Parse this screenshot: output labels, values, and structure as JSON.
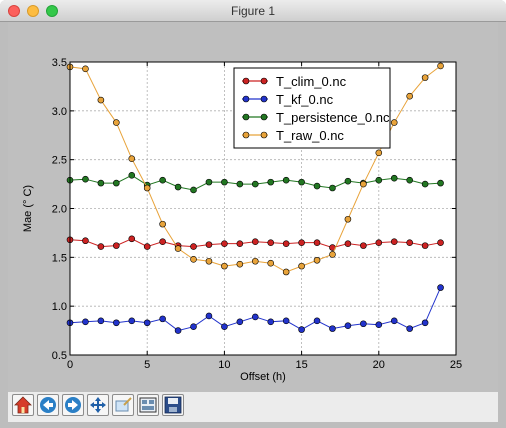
{
  "window": {
    "title": "Figure 1"
  },
  "toolbar": {
    "buttons": [
      {
        "name": "home-button",
        "icon": "home-icon"
      },
      {
        "name": "back-button",
        "icon": "arrow-left-icon"
      },
      {
        "name": "forward-button",
        "icon": "arrow-right-icon"
      },
      {
        "name": "pan-button",
        "icon": "move-icon"
      },
      {
        "name": "zoom-button",
        "icon": "zoom-rect-icon"
      },
      {
        "name": "subplots-button",
        "icon": "subplots-icon"
      },
      {
        "name": "save-button",
        "icon": "save-icon"
      }
    ]
  },
  "chart_data": {
    "type": "line",
    "title": "",
    "xlabel": "Offset (h)",
    "ylabel": "Mae (° C)",
    "xlim": [
      0,
      25
    ],
    "ylim": [
      0.5,
      3.5
    ],
    "xticks": [
      0,
      5,
      10,
      15,
      20,
      25
    ],
    "yticks": [
      0.5,
      1.0,
      1.5,
      2.0,
      2.5,
      3.0,
      3.5
    ],
    "xtick_labels": [
      "0",
      "5",
      "10",
      "15",
      "20",
      "25"
    ],
    "ytick_labels": [
      "0.5",
      "1.0",
      "1.5",
      "2.0",
      "2.5",
      "3.0",
      "3.5"
    ],
    "grid": true,
    "legend_position": "top-right",
    "x": [
      0,
      1,
      2,
      3,
      4,
      5,
      6,
      7,
      8,
      9,
      10,
      11,
      12,
      13,
      14,
      15,
      16,
      17,
      18,
      19,
      20,
      21,
      22,
      23,
      24
    ],
    "series": [
      {
        "name": "T_clim_0.nc",
        "color": "#cc2222",
        "values": [
          1.68,
          1.67,
          1.61,
          1.62,
          1.69,
          1.61,
          1.66,
          1.62,
          1.61,
          1.63,
          1.64,
          1.64,
          1.66,
          1.65,
          1.64,
          1.65,
          1.65,
          1.6,
          1.64,
          1.62,
          1.65,
          1.66,
          1.65,
          1.62,
          1.65
        ]
      },
      {
        "name": "T_kf_0.nc",
        "color": "#2233cc",
        "values": [
          0.83,
          0.84,
          0.85,
          0.83,
          0.85,
          0.83,
          0.87,
          0.75,
          0.79,
          0.9,
          0.79,
          0.84,
          0.89,
          0.84,
          0.85,
          0.76,
          0.85,
          0.77,
          0.8,
          0.82,
          0.81,
          0.85,
          0.77,
          0.83,
          1.19
        ]
      },
      {
        "name": "T_persistence_0.nc",
        "color": "#227722",
        "values": [
          2.29,
          2.3,
          2.26,
          2.26,
          2.34,
          2.24,
          2.29,
          2.22,
          2.19,
          2.27,
          2.27,
          2.25,
          2.25,
          2.27,
          2.29,
          2.27,
          2.23,
          2.21,
          2.28,
          2.26,
          2.29,
          2.31,
          2.29,
          2.25,
          2.26
        ]
      },
      {
        "name": "T_raw_0.nc",
        "color": "#e8a33a",
        "values": [
          3.45,
          3.43,
          3.11,
          2.88,
          2.51,
          2.21,
          1.84,
          1.59,
          1.48,
          1.46,
          1.41,
          1.43,
          1.46,
          1.44,
          1.35,
          1.41,
          1.47,
          1.53,
          1.89,
          2.25,
          2.57,
          2.88,
          3.15,
          3.34,
          3.46
        ]
      }
    ]
  }
}
